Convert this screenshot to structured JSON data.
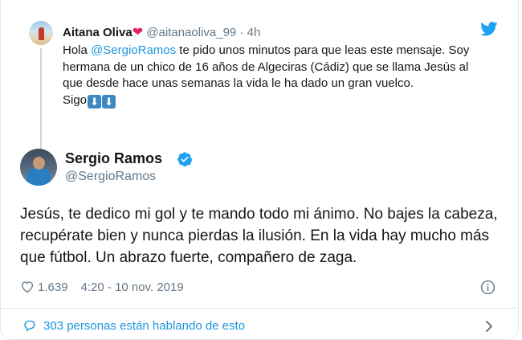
{
  "quoted_tweet": {
    "name": "Aitana Oliva",
    "heart_emoji": "❤",
    "handle": "@aitanaoliva_99",
    "separator": "·",
    "time": "4h",
    "text_intro": "Hola ",
    "mention": "@SergioRamos",
    "text_rest": " te pido unos minutos para que leas este mensaje. Soy hermana de un chico de 16 años de Algeciras (Cádiz) que se llama Jesús al que desde hace unas semanas la vida le ha dado un gran vuelco.",
    "text_sigo": "Sigo",
    "arrow_emoji": "⬇",
    "avatar_icon": "avatar-photo"
  },
  "main_tweet": {
    "name": "Sergio Ramos",
    "handle": "@SergioRamos",
    "verified_icon": "verified-badge-icon",
    "text": "Jesús, te dedico mi gol y te mando todo mi ánimo. No bajes la cabeza, recupérate bien y nunca pierdas la ilusión. En la vida hay mucho más que fútbol. Un abrazo fuerte, compañero de zaga.",
    "likes": "1.639",
    "timestamp": "4:20 - 10 nov. 2019"
  },
  "footer": {
    "talking_label": "303 personas están hablando de esto"
  },
  "icons": {
    "brand": "twitter-bird-icon",
    "like": "heart-outline-icon",
    "info": "info-icon",
    "reply": "comment-bubble-icon",
    "chevron": "chevron-right-icon"
  },
  "colors": {
    "link": "#1b95e0",
    "muted": "#657786",
    "text": "#14171a",
    "heart": "#e0245e",
    "border": "#e1e8ed"
  }
}
